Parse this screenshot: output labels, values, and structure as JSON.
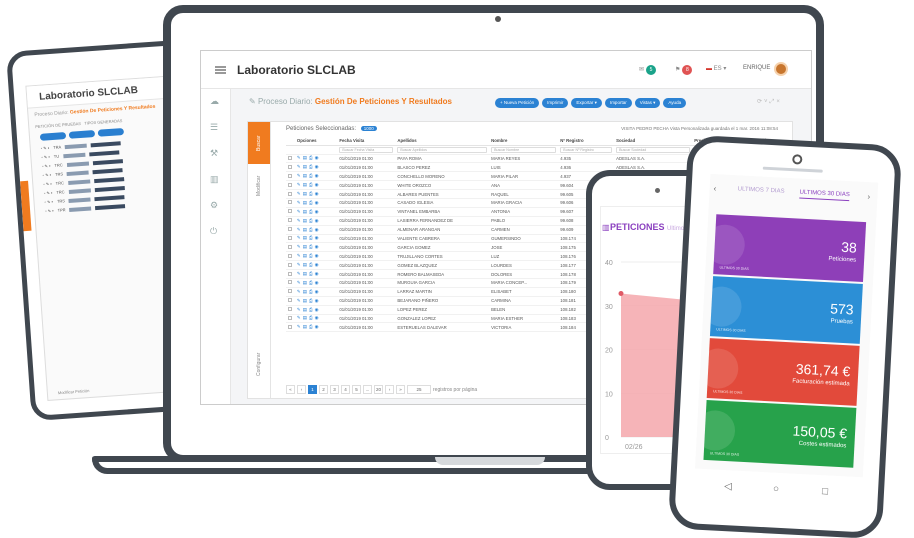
{
  "tablet": {
    "title": "Laboratorio SLCLAB",
    "crumb_prefix": "Proceso Diario",
    "crumb_title": "Gestión De Peticiones Y Resultados",
    "subtabs": [
      "PETICIÓN DE PRUEBAS",
      "TIPOS GENERADAS"
    ],
    "rows": [
      "TRA",
      "TU",
      "TRC",
      "TRS",
      "TRC",
      "TRC",
      "TRS",
      "TPR"
    ],
    "footer": "Modificar Petición"
  },
  "app": {
    "title": "Laboratorio SLCLAB",
    "user": "ENRIQUE",
    "badges": [
      {
        "count": "5",
        "color": "#1aa38a"
      },
      {
        "count": "8",
        "color": "#e05353"
      }
    ],
    "lang": "ES"
  },
  "sidebar_icons": [
    "cloud-icon",
    "list-icon",
    "gavel-icon",
    "chart-icon",
    "gear-icon",
    "power-icon"
  ],
  "breadcrumb": {
    "prefix": "Proceso Diario:",
    "title": "Gestión De Peticiones Y Resultados"
  },
  "actions": [
    "+ Nueva Petición",
    "Imprimir",
    "Exportar ▾",
    "Importar",
    "Vistas ▾",
    "Ayuda"
  ],
  "vertical_tabs": [
    "Buscar",
    "Modificar",
    "Configurar"
  ],
  "selection": {
    "label": "Peticiones Seleccionadas:",
    "count": "1000"
  },
  "visit_info": "VISITA PEDRO PECHA  Vista Personalizada guardada el 1 mar. 2016 11:08:54",
  "grid": {
    "columns": [
      "",
      "Opciones",
      "Fecha Visita",
      "Apellidos",
      "Nombre",
      "Nº Registro",
      "Sociedad",
      "Precio",
      "Estado"
    ],
    "filters": [
      "",
      "",
      "Buscar Fecha Visita",
      "Buscar Apellidos",
      "Buscar Nombre",
      "Buscar Nº Registro",
      "Buscar Sociedad",
      "Buscar Precio",
      ""
    ],
    "rows": [
      [
        "01/01/2019 01:00",
        "PAYA ROMA",
        "MARIA REYES",
        "4.935",
        "ADESLAS S.A.",
        "13,09 €"
      ],
      [
        "01/01/2019 01:00",
        "BLASCO PEREZ",
        "LUIS",
        "4.936",
        "ADESLAS S.A.",
        ""
      ],
      [
        "01/01/2019 01:00",
        "CONCHELLO MORENO",
        "MARIA PILAR",
        "4.937",
        "ADESLAS S.A.",
        ""
      ],
      [
        "01/01/2019 01:00",
        "WHITE OROZCO",
        "ANA",
        "99.604",
        "CASER SEGUROS",
        ""
      ],
      [
        "01/01/2019 01:00",
        "ALBARES PUENTES",
        "RAQUEL",
        "99.605",
        "ADESLAS S.A.",
        ""
      ],
      [
        "01/01/2019 01:00",
        "CASADO IGLESIA",
        "MARIA GRACIA",
        "99.606",
        "ASISA",
        ""
      ],
      [
        "01/01/2019 01:00",
        "VINTANEL EMBARBA",
        "ANTONIA",
        "99.607",
        "CASER SEGUROS",
        ""
      ],
      [
        "01/01/2019 01:00",
        "LASIERRA FERNANDEZ DE",
        "PABLO",
        "99.608",
        "ASISA",
        ""
      ],
      [
        "01/01/2019 01:00",
        "ALMENAR ARANGAN",
        "CARMEN",
        "99.609",
        "ASISA",
        ""
      ],
      [
        "01/01/2019 01:00",
        "VALIENTE CABRERA",
        "GUMERSINDO",
        "108.174",
        "ASISA",
        ""
      ],
      [
        "01/01/2019 01:00",
        "GARCIA GOMEZ",
        "JOSE",
        "108.175",
        "ASISA",
        ""
      ],
      [
        "01/01/2019 01:00",
        "TRUJILLANO CORTES",
        "LUZ",
        "108.176",
        "SANITAS, S.A.",
        ""
      ],
      [
        "01/01/2019 01:00",
        "GOMEZ BLAZQUEZ",
        "LOURDES",
        "108.177",
        "ADESLAS S.A.",
        ""
      ],
      [
        "01/01/2019 01:00",
        "ROMERO BALMASEDA",
        "DOLORES",
        "108.178",
        "ASISA",
        ""
      ],
      [
        "01/01/2019 01:00",
        "MURGUIA GARCIA",
        "MARIA CONCEP...",
        "108.179",
        "ASISA",
        ""
      ],
      [
        "01/01/2019 01:00",
        "LARRAZ MARTIN",
        "ELISABET",
        "108.180",
        "ASISA",
        ""
      ],
      [
        "01/01/2019 01:00",
        "BEJARANO PIÑERO",
        "CARMINA",
        "108.181",
        "ASISA",
        ""
      ],
      [
        "01/01/2019 01:00",
        "LOPEZ PEREZ",
        "BELEN",
        "108.182",
        "ASISA",
        ""
      ],
      [
        "01/01/2019 01:00",
        "GONZALEZ LOPEZ",
        "MARIA ESTHER",
        "108.183",
        "ASISA",
        ""
      ],
      [
        "01/01/2019 01:00",
        "ESTERUELAS DALEVAR",
        "VICTORIA",
        "108.184",
        "SANITAS, S.A. DE",
        ""
      ]
    ]
  },
  "pagination": {
    "pages": [
      "1",
      "2",
      "3",
      "4",
      "5",
      "...",
      "20"
    ],
    "first": "«",
    "prev": "‹",
    "next": "›",
    "last": "»",
    "page_size": "25",
    "page_size_label": "registros por página"
  },
  "phone1": {
    "title": "PETICIONES",
    "subtitle": "Ultimos",
    "y_ticks": [
      "40",
      "30",
      "20",
      "10",
      "0"
    ],
    "x_label": "02/26",
    "chart_color": "#f4a7ab",
    "area_fraction": 0.82
  },
  "phone2": {
    "tabs": [
      "ULTIMOS 7 DIAS",
      "ULTIMOS 30 DIAS"
    ],
    "cards": [
      {
        "value": "38",
        "label": "Peticiones",
        "footer": "ULTIMOS 30 DIAS",
        "color": "#8e3fb8"
      },
      {
        "value": "573",
        "label": "Pruebas",
        "footer": "ULTIMOS 30 DIAS",
        "color": "#2c8fd6"
      },
      {
        "value": "361,74 €",
        "label": "Facturación estimada",
        "footer": "ULTIMOS 30 DIAS",
        "color": "#e24a3b"
      },
      {
        "value": "150,05 €",
        "label": "Costes estimados",
        "footer": "ULTIMOS 30 DIAS",
        "color": "#27a24b"
      }
    ],
    "nav_keys": [
      "◁",
      "○",
      "□"
    ]
  }
}
